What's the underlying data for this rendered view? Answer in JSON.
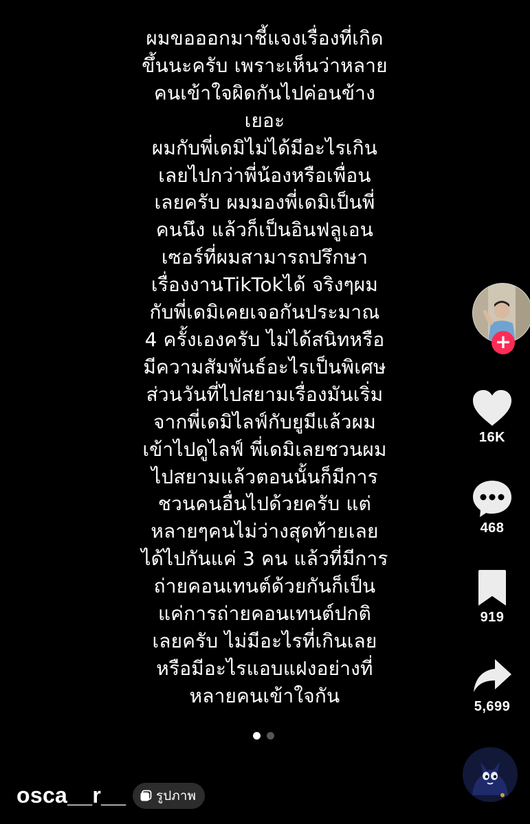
{
  "caption": {
    "lines": [
      "ผมขอออกมาชี้แจงเรื่องที่เกิด",
      "ขึ้นนะครับ เพราะเห็นว่าหลาย",
      "คนเข้าใจผิดกันไปค่อนข้าง",
      "เยอะ",
      "ผมกับพี่เดมิไม่ได้มีอะไรเกิน",
      "เลยไปกว่าพี่น้องหรือเพื่อน",
      "เลยครับ ผมมองพี่เดมิเป็นพี่",
      "คนนึง แล้วก็เป็นอินฟลูเอน",
      "เซอร์ที่ผมสามารถปรึกษา",
      "เรื่องงานTikTokได้ จริงๆผม",
      "กับพี่เดมิเคยเจอกันประมาณ",
      "4 ครั้งเองครับ ไม่ได้สนิทหรือ",
      "มีความสัมพันธ์อะไรเป็นพิเศษ",
      "ส่วนวันที่ไปสยามเรื่องมันเริ่ม",
      "จากพี่เดมิไลฟ์กับยูมีแล้วผม",
      "เข้าไปดูไลฟ์ พี่เดมิเลยชวนผม",
      "ไปสยามแล้วตอนนั้นก็มีการ",
      "ชวนคนอื่นไปด้วยครับ แต่",
      "หลายๆคนไม่ว่างสุดท้ายเลย",
      "ได้ไปกันแค่ 3 คน แล้วที่มีการ",
      "ถ่ายคอนเทนต์ด้วยกันก็เป็น",
      "แค่การถ่ายคอนเทนต์ปกติ",
      "เลยครับ ไม่มีอะไรที่เกินเลย",
      "หรือมีอะไรแอบแฝงอย่างที่",
      "หลายคนเข้าใจกัน"
    ]
  },
  "rail": {
    "avatar_icon": "profile-avatar",
    "follow_icon": "plus-icon",
    "follow_symbol": "+",
    "like": {
      "icon": "heart-icon",
      "count": "16K"
    },
    "comment": {
      "icon": "comment-icon",
      "count": "468"
    },
    "bookmark": {
      "icon": "bookmark-icon",
      "count": "919"
    },
    "share": {
      "icon": "share-icon",
      "count": "5,699"
    },
    "music_icon": "music-disc"
  },
  "carousel": {
    "total": 2,
    "active_index": 0
  },
  "footer": {
    "username": "osca__r__",
    "photo_chip_icon": "photo-icon",
    "photo_chip_label": "รูปภาพ"
  },
  "colors": {
    "background": "#000000",
    "text": "#ffffff",
    "follow_accent": "#fe2c55",
    "chip_background": "#2c2c2c",
    "dot_inactive": "#555555"
  }
}
